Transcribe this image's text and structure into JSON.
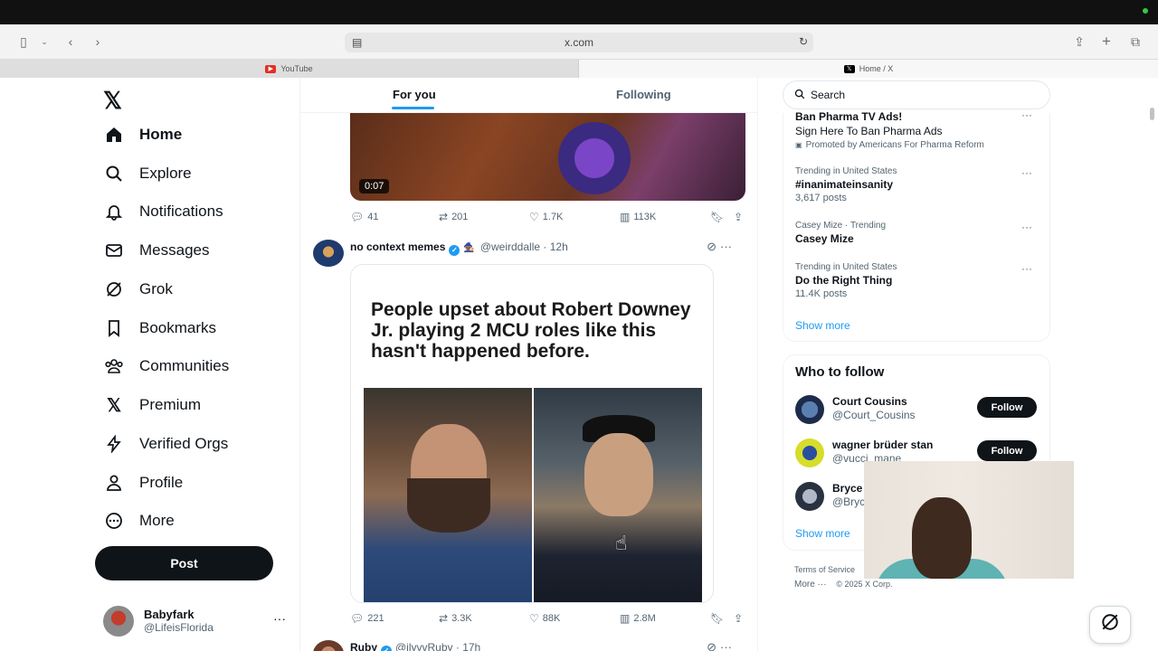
{
  "browser": {
    "url": "x.com",
    "tabs": [
      {
        "label": "YouTube",
        "active": false
      },
      {
        "label": "Home / X",
        "active": true
      }
    ]
  },
  "sidebar": {
    "nav": [
      {
        "label": "Home",
        "icon": "home-icon"
      },
      {
        "label": "Explore",
        "icon": "search-icon"
      },
      {
        "label": "Notifications",
        "icon": "bell-icon"
      },
      {
        "label": "Messages",
        "icon": "mail-icon"
      },
      {
        "label": "Grok",
        "icon": "grok-icon"
      },
      {
        "label": "Bookmarks",
        "icon": "bookmark-icon"
      },
      {
        "label": "Communities",
        "icon": "people-icon"
      },
      {
        "label": "Premium",
        "icon": "x-logo-icon"
      },
      {
        "label": "Verified Orgs",
        "icon": "lightning-icon"
      },
      {
        "label": "Profile",
        "icon": "person-icon"
      },
      {
        "label": "More",
        "icon": "more-circle-icon"
      }
    ],
    "post_label": "Post",
    "account": {
      "name": "Babyfark",
      "handle": "@LifeisFlorida"
    }
  },
  "feed": {
    "tabs": [
      "For you",
      "Following"
    ],
    "tweet1": {
      "video_time": "0:07",
      "replies": "41",
      "reposts": "201",
      "likes": "1.7K",
      "views": "113K"
    },
    "tweet2": {
      "name": "no context memes",
      "handle": "@weirddalle",
      "time": "· 12h",
      "meme_text": "People upset about Robert Downey Jr. playing 2 MCU roles like this hasn't happened before.",
      "replies": "221",
      "reposts": "3.3K",
      "likes": "88K",
      "views": "2.8M"
    },
    "tweet3": {
      "name": "Ruby",
      "handle": "@ilyvvRuby",
      "time": "· 17h"
    }
  },
  "right": {
    "search_placeholder": "Search",
    "trends": [
      {
        "category": "",
        "title": "Ban Pharma TV Ads!",
        "sub": "Sign Here To Ban Pharma Ads",
        "promo": "Promoted by Americans For Pharma Reform"
      },
      {
        "category": "Trending in United States",
        "title": "#inanimateinsanity",
        "sub": "3,617 posts"
      },
      {
        "category": "Casey Mize · Trending",
        "title": "Casey Mize",
        "sub": ""
      },
      {
        "category": "Trending in United States",
        "title": "Do the Right Thing",
        "sub": "11.4K posts"
      }
    ],
    "show_more": "Show more",
    "who_to_follow": {
      "title": "Who to follow",
      "users": [
        {
          "name": "Court Cousins",
          "handle": "@Court_Cousins",
          "button": "Follow"
        },
        {
          "name": "wagner brüder stan",
          "handle": "@vucci_mane",
          "button": "Follow"
        },
        {
          "name": "Bryce",
          "handle": "@Bryc"
        }
      ],
      "show_more": "Show more"
    },
    "footer": {
      "links": "Terms of Service",
      "more": "More ···",
      "copyright": "© 2025 X Corp."
    }
  },
  "colors": {
    "accent": "#1d9bf0",
    "text": "#0f1419",
    "muted": "#536471"
  }
}
